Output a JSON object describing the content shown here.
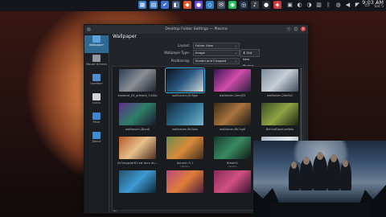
{
  "taskbar": {
    "clock_time": "9:03 AM",
    "clock_date": "Sat 5",
    "task_icons": [
      {
        "name": "files-app-icon",
        "color": "#3d7bc9",
        "glyph": "▦"
      },
      {
        "name": "files-app-icon-2",
        "color": "#3d7bc9",
        "glyph": "▤"
      },
      {
        "name": "settings-icon",
        "color": "#3c6fd1",
        "glyph": "✔"
      },
      {
        "name": "media-icon",
        "color": "#3b4f70",
        "glyph": "◧"
      },
      {
        "name": "brave-browser-icon",
        "color": "#e2572b",
        "glyph": "◆"
      },
      {
        "name": "browser-icon",
        "color": "#6b4ad6",
        "glyph": "●"
      },
      {
        "name": "code-icon",
        "color": "#2f80c3",
        "glyph": "◇"
      },
      {
        "name": "mail-icon",
        "color": "#4a5060",
        "glyph": "✉"
      },
      {
        "name": "spotify-icon",
        "color": "#1db954",
        "glyph": "◉"
      },
      {
        "name": "steam-icon",
        "color": "#1f3246",
        "glyph": "◎"
      },
      {
        "name": "music-icon",
        "color": "#343a44",
        "glyph": "♪"
      },
      {
        "name": "github-icon",
        "color": "#2a2d33",
        "glyph": "●"
      },
      {
        "name": "game-icon",
        "color": "#c53a3a",
        "glyph": "◈"
      }
    ],
    "tray_icons": [
      {
        "name": "gpu-tray-icon",
        "glyph": "▣"
      },
      {
        "name": "discord-tray-icon",
        "glyph": "◐"
      },
      {
        "name": "chat-tray-icon",
        "glyph": "◑"
      },
      {
        "name": "clipboard-tray-icon",
        "glyph": "▥"
      },
      {
        "name": "bluetooth-tray-icon",
        "glyph": "ᛒ"
      },
      {
        "name": "notifications-tray-icon",
        "glyph": "◍"
      },
      {
        "name": "volume-tray-icon",
        "glyph": "◀"
      },
      {
        "name": "network-tray-icon",
        "glyph": "◤"
      },
      {
        "name": "battery-tray-icon",
        "glyph": "▭"
      },
      {
        "name": "expand-tray-icon",
        "glyph": "⌃"
      }
    ]
  },
  "window": {
    "title": "Desktop Folder Settings — Plasma",
    "minimize": "–",
    "maximize": "□",
    "close": "×"
  },
  "sidebar": {
    "items": [
      {
        "name": "sidebar-item-wallpaper",
        "label": "Wallpaper",
        "color": "#5aa3dc",
        "active": true
      },
      {
        "name": "sidebar-item-mouse-actions",
        "label": "Mouse Actions",
        "color": "#8f98a3",
        "active": false
      },
      {
        "name": "sidebar-item-location",
        "label": "Location",
        "color": "#4f8ed1",
        "active": false
      },
      {
        "name": "sidebar-item-icons",
        "label": "Icons",
        "color": "#d0d4d9",
        "active": false
      },
      {
        "name": "sidebar-item-filter",
        "label": "Filter",
        "color": "#3d86d4",
        "active": false
      },
      {
        "name": "sidebar-item-about",
        "label": "About",
        "color": "#3e8fd9",
        "active": false
      }
    ]
  },
  "main": {
    "title": "Wallpaper",
    "layout_label": "Layout:",
    "layout_value": "Folder View",
    "wallpaper_type_label": "Wallpaper Type:",
    "wallpaper_type_value": "Image",
    "get_plugins_label": "Get New Plugins...",
    "positioning_label": "Positioning:",
    "positioning_value": "Scaled and Cropped"
  },
  "wallpapers": [
    {
      "label": "expanse_S4_artwork_1440p",
      "sub": "",
      "colors": [
        "#2b3d55",
        "#8c8f95",
        "#1a2230"
      ],
      "selected": false
    },
    {
      "label": "wallhaven-j5h5gw",
      "sub": "",
      "colors": [
        "#0a1220",
        "#2c5a83",
        "#d6d9dc"
      ],
      "selected": true
    },
    {
      "label": "wallhaven-1emj53",
      "sub": "",
      "colors": [
        "#3a1455",
        "#d04caa",
        "#2a1f40"
      ],
      "selected": false
    },
    {
      "label": "wallhaven-2eb9n2",
      "sub": "",
      "colors": [
        "#7a8b9c",
        "#c7ced6",
        "#3d4b5a"
      ],
      "selected": false
    },
    {
      "label": "wallhaven-48xrdj",
      "sub": "",
      "colors": [
        "#5d2e8a",
        "#2d7f66",
        "#1a1530"
      ],
      "selected": false
    },
    {
      "label": "wallhaven-6k3xox",
      "sub": "",
      "colors": [
        "#112638",
        "#2d6b8c",
        "#78b5cc"
      ],
      "selected": false
    },
    {
      "label": "wallhaven-6k7vg6",
      "sub": "",
      "colors": [
        "#3a2b18",
        "#a8743e",
        "#1c1a14"
      ],
      "selected": false
    },
    {
      "label": "BehindDoorLeaflets",
      "sub": "",
      "colors": [
        "#3b4d23",
        "#8fa344",
        "#1c2412"
      ],
      "selected": false
    },
    {
      "label": "jfv3vsyp4dr81 est burn du...",
      "sub": "",
      "colors": [
        "#b45a2a",
        "#e8c08c",
        "#4c2a1a"
      ],
      "selected": false
    },
    {
      "label": "Autumn 5.1",
      "sub": "Ubuntu",
      "colors": [
        "#6d8b4d",
        "#d88b3a",
        "#3e2b1e"
      ],
      "selected": false
    },
    {
      "label": "Breath1",
      "sub": "Ubuntu",
      "colors": [
        "#123d2c",
        "#3a8a63",
        "#0e1a14"
      ],
      "selected": false
    },
    {
      "label": "Breath2",
      "sub": "",
      "colors": [
        "#a8b8c6",
        "#e1e6ea",
        "#6c8196"
      ],
      "selected": false
    },
    {
      "label": "",
      "sub": "",
      "colors": [
        "#24516f",
        "#3d9ad2",
        "#0c2434"
      ],
      "selected": false
    },
    {
      "label": "",
      "sub": "",
      "colors": [
        "#b84a7a",
        "#e07d3a",
        "#4a1f3a"
      ],
      "selected": false
    },
    {
      "label": "",
      "sub": "",
      "colors": [
        "#8a2a5a",
        "#d05080",
        "#3a1230"
      ],
      "selected": false
    },
    {
      "label": "",
      "sub": "",
      "colors": [
        "#5a3a8a",
        "#c8b0e0",
        "#2a1a40"
      ],
      "selected": false
    }
  ],
  "grid_footer": {
    "back_icon": "←",
    "forward_icon": "→"
  }
}
